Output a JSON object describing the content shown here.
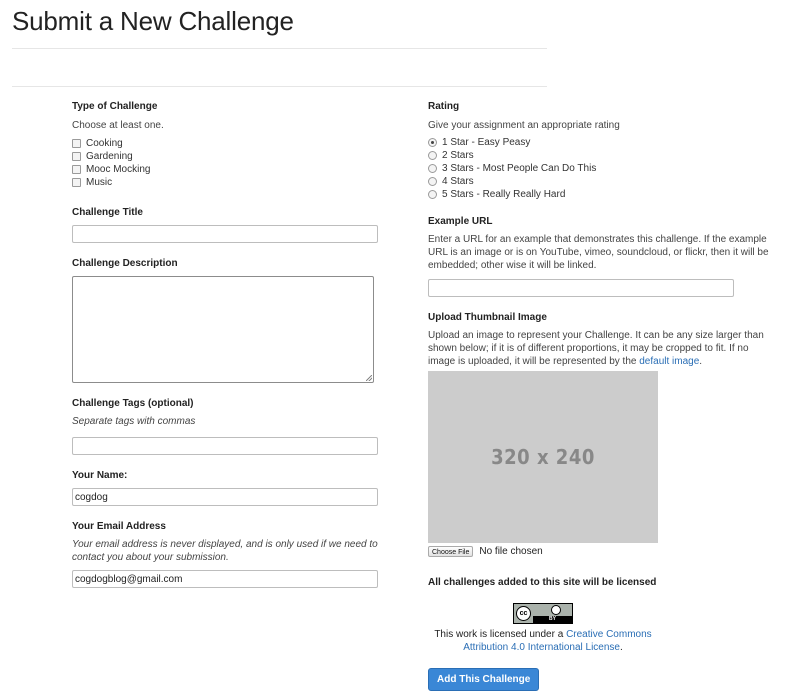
{
  "page": {
    "title": "Submit a New Challenge"
  },
  "type_of_challenge": {
    "label": "Type of Challenge",
    "help": "Choose at least one.",
    "options": [
      "Cooking",
      "Gardening",
      "Mooc Mocking",
      "Music"
    ]
  },
  "challenge_title": {
    "label": "Challenge Title",
    "value": ""
  },
  "challenge_description": {
    "label": "Challenge Description",
    "value": ""
  },
  "challenge_tags": {
    "label": "Challenge Tags (optional)",
    "help": "Separate tags with commas",
    "value": ""
  },
  "your_name": {
    "label": "Your Name:",
    "value": "cogdog"
  },
  "your_email": {
    "label": "Your Email Address",
    "help": "Your email address is never displayed, and is only used if we need to contact you about your submission.",
    "value": "cogdogblog@gmail.com"
  },
  "rating": {
    "label": "Rating",
    "help": "Give your assignment an appropriate rating",
    "options": [
      "1 Star - Easy Peasy",
      "2 Stars",
      "3 Stars - Most People Can Do This",
      "4 Stars",
      "5 Stars - Really Really Hard"
    ],
    "selected": "1 Star - Easy Peasy"
  },
  "example_url": {
    "label": "Example URL",
    "help": "Enter a URL for an example that demonstrates this challenge. If the example URL is an image or is on YouTube, vimeo, soundcloud, or flickr, then it will be embedded; other wise it will be linked.",
    "value": ""
  },
  "thumbnail": {
    "label": "Upload Thumbnail Image",
    "help_before": "Upload an image to represent your Challenge. It can be any size larger than shown below; if it is of different proportions, it may be cropped to fit. If no image is uploaded, it will be represented by the ",
    "help_link": "default image",
    "help_after": ".",
    "placeholder_text": "320 x 240",
    "choose_file_label": "Choose File",
    "file_status": "No file chosen"
  },
  "license": {
    "notice": "All challenges added to this site will be licensed",
    "badge_cc": "cc",
    "badge_by": "BY",
    "text_before": "This work is licensed under a ",
    "link_text": "Creative Commons Attribution 4.0 International License",
    "text_after": "."
  },
  "submit": {
    "label": "Add This Challenge"
  },
  "colors": {
    "accent": "#3a87d6",
    "link": "#2a6eb5",
    "thumb_bg": "#cccccc"
  }
}
